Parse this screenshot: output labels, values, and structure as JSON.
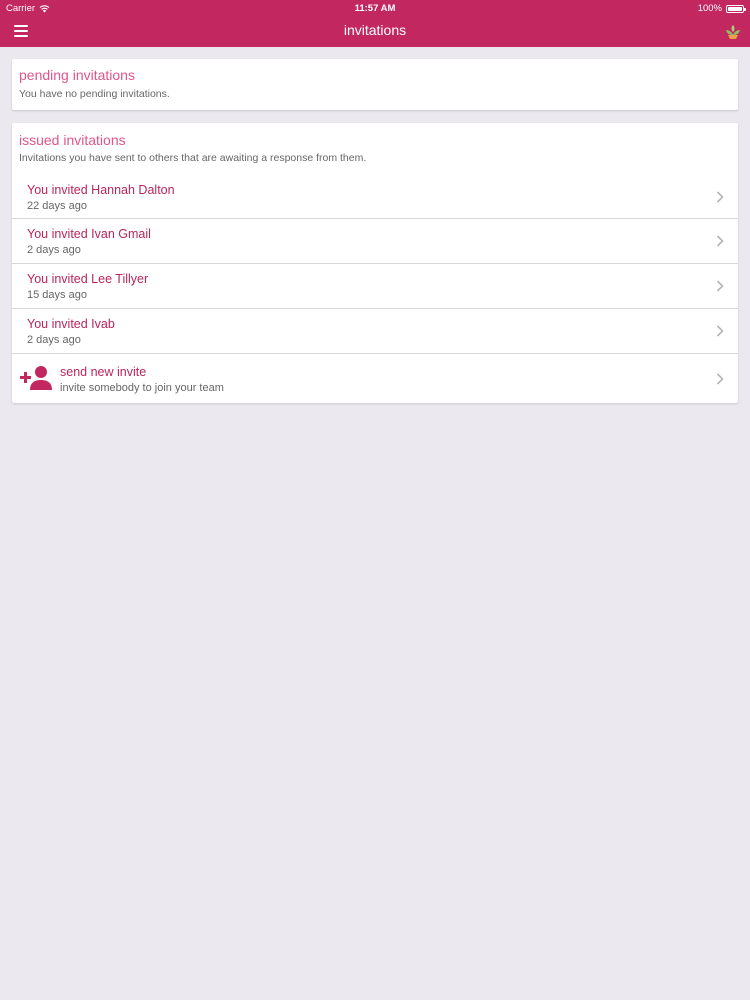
{
  "status_bar": {
    "carrier": "Carrier",
    "time": "11:57 AM",
    "battery": "100%"
  },
  "header": {
    "title": "invitations"
  },
  "pending": {
    "title": "pending invitations",
    "subtitle": "You have no pending invitations."
  },
  "issued": {
    "title": "issued invitations",
    "subtitle": "Invitations you have sent to others that are awaiting a response from them.",
    "items": [
      {
        "label": "You invited Hannah Dalton",
        "ago": "22 days ago"
      },
      {
        "label": "You invited Ivan Gmail",
        "ago": "2 days ago"
      },
      {
        "label": "You invited Lee Tillyer",
        "ago": "15 days ago"
      },
      {
        "label": "You invited Ivab",
        "ago": "2 days ago"
      }
    ],
    "new_invite": {
      "label": "send new invite",
      "sub": "invite somebody to join your team"
    }
  },
  "colors": {
    "brand": "#c2275f",
    "accent_text": "#b8265c",
    "section_title": "#e0568a",
    "background": "#ebe9ef"
  }
}
